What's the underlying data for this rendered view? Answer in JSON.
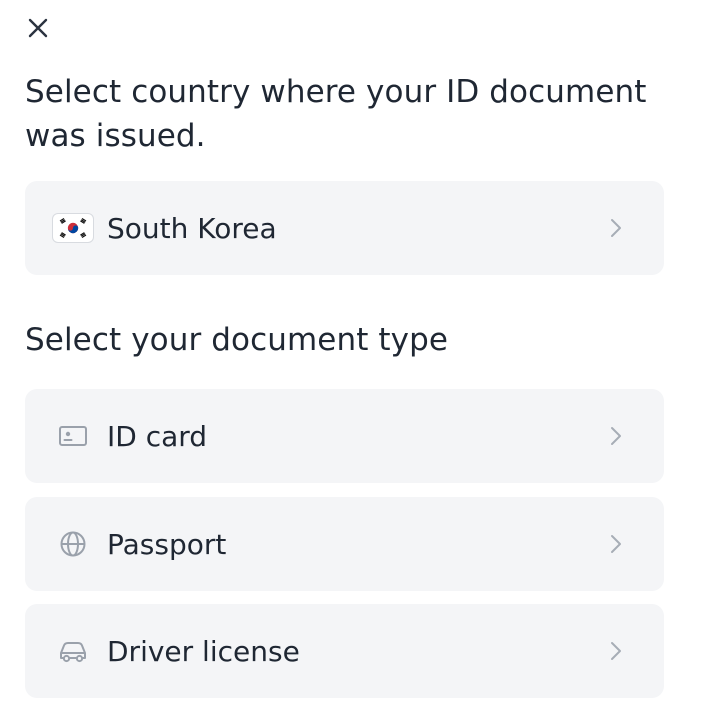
{
  "close": {
    "icon": "close-icon"
  },
  "country_section": {
    "heading": "Select country where your ID document was issued.",
    "selected_country": {
      "label": "South Korea",
      "flag_icon": "south-korea-flag-icon"
    }
  },
  "document_section": {
    "heading": "Select your document type",
    "options": [
      {
        "label": "ID card",
        "icon": "id-card-icon"
      },
      {
        "label": "Passport",
        "icon": "globe-icon"
      },
      {
        "label": "Driver license",
        "icon": "car-icon"
      }
    ]
  },
  "colors": {
    "text": "#1f2733",
    "option_background": "#f4f5f7",
    "icon_gray": "#9aa1ab",
    "chevron_gray": "#a7adb6"
  }
}
